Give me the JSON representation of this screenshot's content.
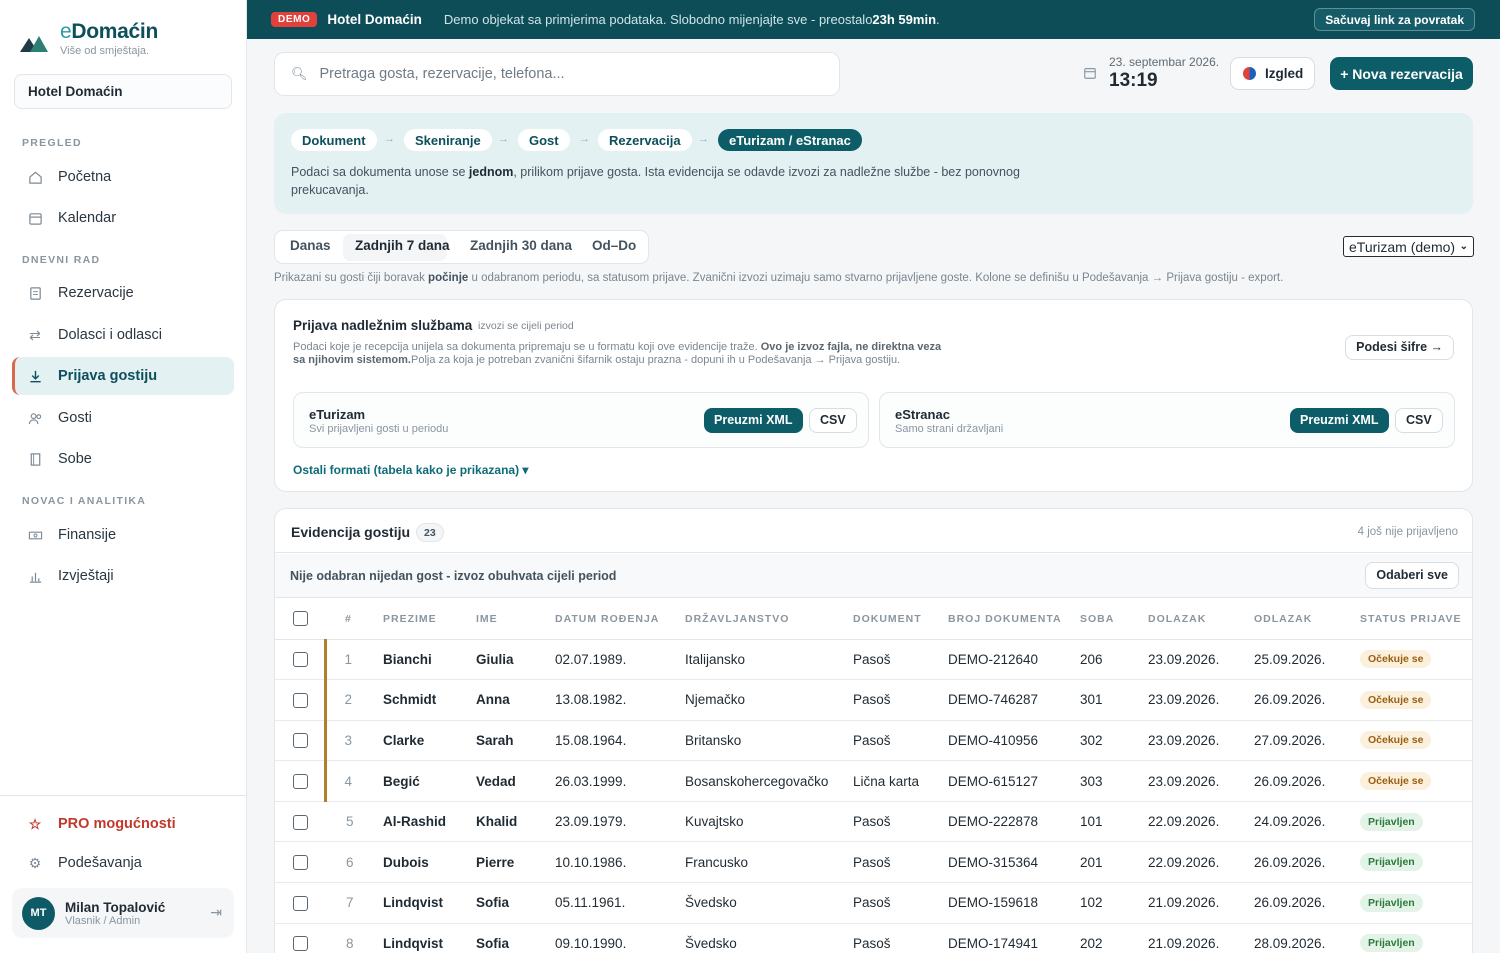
{
  "sidebar": {
    "brand_first": "e",
    "brand_rest": "Domaćin",
    "tagline": "Više od smještaja.",
    "hotel": "Hotel Domaćin",
    "sections": [
      "PREGLED",
      "DNEVNI RAD",
      "NOVAC I ANALITIKA"
    ],
    "items": [
      {
        "label": "Početna",
        "icon": "home-icon"
      },
      {
        "label": "Kalendar",
        "icon": "calendar-icon"
      },
      {
        "label": "Rezervacije",
        "icon": "document-icon"
      },
      {
        "label": "Dolasci i odlasci",
        "icon": "swap-arrows-icon"
      },
      {
        "label": "Prijava gostiju",
        "icon": "download-icon",
        "active": true
      },
      {
        "label": "Gosti",
        "icon": "users-icon"
      },
      {
        "label": "Sobe",
        "icon": "door-icon"
      },
      {
        "label": "Finansije",
        "icon": "money-icon"
      },
      {
        "label": "Izvještaji",
        "icon": "bar-chart-icon"
      }
    ],
    "pro": "PRO mogućnosti",
    "settings": "Podešavanja",
    "user": {
      "initials": "MT",
      "name": "Milan Topalović",
      "role": "Vlasnik / Admin"
    }
  },
  "banner": {
    "badge": "DEMO",
    "hotel": "Hotel Domaćin",
    "message": "Demo objekat sa primjerima podataka. Slobodno mijenjajte sve - preostalo",
    "remaining": "23h 59min",
    "end": ".",
    "save_link": "Sačuvaj link za povratak"
  },
  "header": {
    "search_placeholder": "Pretraga gosta, rezervacije, telefona...",
    "date": "23. septembar 2026.",
    "time": "13:19",
    "look": "Izgled",
    "new_reservation": "+ Nova rezervacija"
  },
  "flow": {
    "steps": [
      "Dokument",
      "Skeniranje",
      "Gost",
      "Rezervacija",
      "eTurizam / eStranac"
    ],
    "arrow": "→",
    "text_a": "Podaci sa dokumenta unose se ",
    "text_b": "jednom",
    "text_c": ", prilikom prijave gosta. Ista evidencija se odavde izvozi za nadležne službe - bez ponovnog prekucavanja."
  },
  "period": {
    "tabs": [
      "Danas",
      "Zadnjih 7 dana",
      "Zadnjih 30 dana",
      "Od–Do"
    ],
    "active": 1,
    "registry_select": "eTurizam (demo)",
    "info_a": "Prikazani su gosti čiji boravak ",
    "info_b": "počinje",
    "info_c": " u odabranom periodu, sa statusom prijave. Zvanični izvozi uzimaju samo stvarno prijavljene goste. Kolone se definišu u Podešavanja → Prijava gostiju - export."
  },
  "authorities": {
    "title": "Prijava nadležnim službama",
    "subtitle": "izvozi se cijeli period",
    "desc_a": "Podaci koje je recepcija unijela sa dokumenta pripremaju se u formatu koji ove evidencije traže. ",
    "desc_b": "Ovo je izvoz fajla, ne direktna veza sa njihovim sistemom.",
    "desc_c": "Polja za koja je potreban zvanični šifarnik ostaju prazna - dopuni ih u Podešavanja → Prijava gostiju.",
    "codes_btn": "Podesi šifre →",
    "exports": [
      {
        "name": "eTurizam",
        "desc": "Svi prijavljeni gosti u periodu",
        "xml": "Preuzmi XML",
        "csv": "CSV"
      },
      {
        "name": "eStranac",
        "desc": "Samo strani državljani",
        "xml": "Preuzmi XML",
        "csv": "CSV"
      }
    ],
    "other_formats": "Ostali formati (tabela kako je prikazana) ▾"
  },
  "guests": {
    "title": "Evidencija gostiju",
    "count": "23",
    "pending": "4 još nije prijavljeno",
    "selection": "Nije odabran nijedan gost - izvoz obuhvata cijeli period",
    "select_all": "Odaberi sve",
    "columns": [
      "#",
      "PREZIME",
      "IME",
      "DATUM ROĐENJA",
      "DRŽAVLJANSTVO",
      "DOKUMENT",
      "BROJ DOKUMENTA",
      "SOBA",
      "DOLAZAK",
      "ODLAZAK",
      "STATUS PRIJAVE"
    ],
    "rows": [
      {
        "n": "1",
        "last": "Bianchi",
        "first": "Giulia",
        "dob": "02.07.1989.",
        "nat": "Italijansko",
        "doc": "Pasoš",
        "docno": "DEMO-212640",
        "room": "206",
        "arr": "23.09.2026.",
        "dep": "25.09.2026.",
        "status": "Očekuje se",
        "pending": true
      },
      {
        "n": "2",
        "last": "Schmidt",
        "first": "Anna",
        "dob": "13.08.1982.",
        "nat": "Njemačko",
        "doc": "Pasoš",
        "docno": "DEMO-746287",
        "room": "301",
        "arr": "23.09.2026.",
        "dep": "26.09.2026.",
        "status": "Očekuje se",
        "pending": true
      },
      {
        "n": "3",
        "last": "Clarke",
        "first": "Sarah",
        "dob": "15.08.1964.",
        "nat": "Britansko",
        "doc": "Pasoš",
        "docno": "DEMO-410956",
        "room": "302",
        "arr": "23.09.2026.",
        "dep": "27.09.2026.",
        "status": "Očekuje se",
        "pending": true
      },
      {
        "n": "4",
        "last": "Begić",
        "first": "Vedad",
        "dob": "26.03.1999.",
        "nat": "Bosanskohercegovačko",
        "doc": "Lična karta",
        "docno": "DEMO-615127",
        "room": "303",
        "arr": "23.09.2026.",
        "dep": "26.09.2026.",
        "status": "Očekuje se",
        "pending": true
      },
      {
        "n": "5",
        "last": "Al-Rashid",
        "first": "Khalid",
        "dob": "23.09.1979.",
        "nat": "Kuvajtsko",
        "doc": "Pasoš",
        "docno": "DEMO-222878",
        "room": "101",
        "arr": "22.09.2026.",
        "dep": "24.09.2026.",
        "status": "Prijavljen",
        "pending": false
      },
      {
        "n": "6",
        "last": "Dubois",
        "first": "Pierre",
        "dob": "10.10.1986.",
        "nat": "Francusko",
        "doc": "Pasoš",
        "docno": "DEMO-315364",
        "room": "201",
        "arr": "22.09.2026.",
        "dep": "26.09.2026.",
        "status": "Prijavljen",
        "pending": false
      },
      {
        "n": "7",
        "last": "Lindqvist",
        "first": "Sofia",
        "dob": "05.11.1961.",
        "nat": "Švedsko",
        "doc": "Pasoš",
        "docno": "DEMO-159618",
        "room": "102",
        "arr": "21.09.2026.",
        "dep": "26.09.2026.",
        "status": "Prijavljen",
        "pending": false
      },
      {
        "n": "8",
        "last": "Lindqvist",
        "first": "Sofia",
        "dob": "09.10.1990.",
        "nat": "Švedsko",
        "doc": "Pasoš",
        "docno": "DEMO-174941",
        "room": "202",
        "arr": "21.09.2026.",
        "dep": "28.09.2026.",
        "status": "Prijavljen",
        "pending": false
      }
    ]
  }
}
